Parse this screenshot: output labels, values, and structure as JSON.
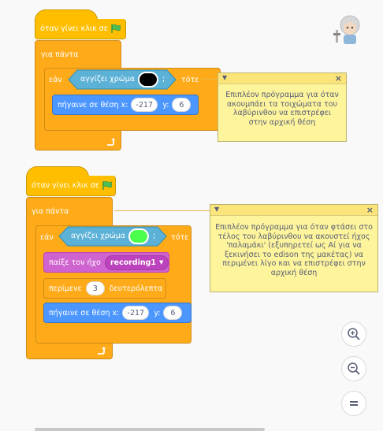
{
  "script1": {
    "hat_label": "όταν γίνει κλικ σε",
    "forever_label": "για πάντα",
    "if_label": "εάν",
    "touching_label": "αγγίζει χρώμα",
    "touching_color": "#000000",
    "then_label": "τότε",
    "goto_label": "πήγαινε σε θέση x:",
    "x_value": "-217",
    "y_label": "y:",
    "y_value": "6"
  },
  "comment1": {
    "text": "Επιπλέον πρόγραμμα για όταν ακουμπάει τα τοιχώματα του λαβύρινθου να επιστρέφει στην αρχική θέση"
  },
  "script2": {
    "hat_label": "όταν γίνει κλικ σε",
    "forever_label": "για πάντα",
    "if_label": "εάν",
    "touching_label": "αγγίζει χρώμα",
    "touching_color": "#4dff4d",
    "then_label": "τότε",
    "sound_label": "παίξε τον ήχο",
    "sound_value": "recording1",
    "wait_label": "περίμενε",
    "wait_value": "3",
    "wait_unit": "δευτερόλεπτα",
    "goto_label": "πήγαινε σε θέση x:",
    "x_value": "-217",
    "y_label": "y:",
    "y_value": "6"
  },
  "comment2": {
    "text": "Επιπλέον πρόγραμμα για όταν φτάσει στο τέλος του λαβύρινθου να ακουστεί ήχος 'παλαμάκι' (εξυπηρετεί ως Αί για να ξεκινήσει το edison της μακέτας) να περιμένει λίγο και να επιστρέφει στην αρχική θέση"
  },
  "icons": {
    "flag": "green-flag-icon",
    "repeat": "loop-arrow-icon",
    "sprite": "sprite-avatar-icon",
    "zoom_in": "zoom-in-icon",
    "zoom_out": "zoom-out-icon",
    "reset": "zoom-reset-icon"
  }
}
